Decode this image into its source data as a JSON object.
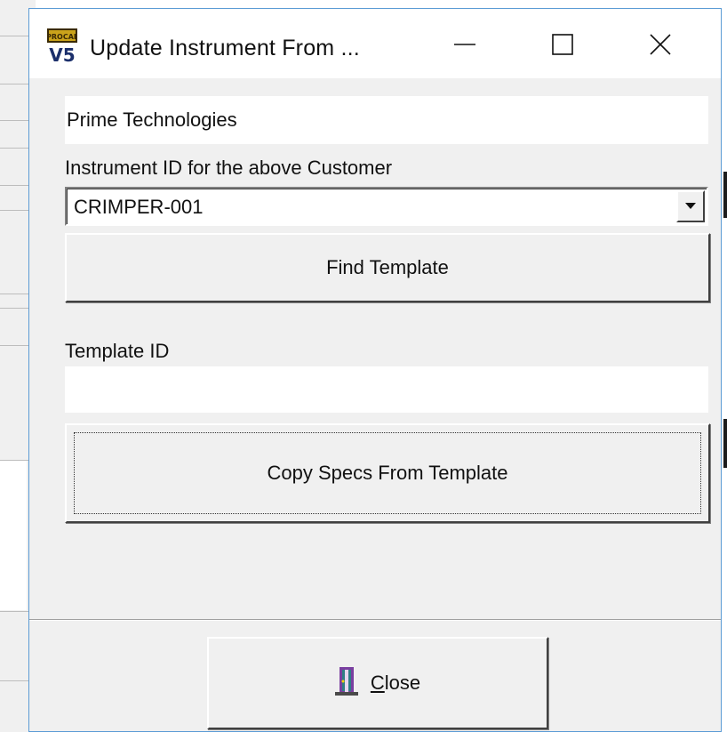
{
  "window": {
    "title": "Update Instrument From ...",
    "controls": {
      "minimize": "minimize-icon",
      "maximize": "maximize-icon",
      "close": "close-icon"
    }
  },
  "customer": {
    "value": "Prime Technologies"
  },
  "instrument": {
    "label": "Instrument ID for the above Customer",
    "selected": "CRIMPER-001"
  },
  "find_template_button": {
    "label": "Find Template"
  },
  "template": {
    "label": "Template ID",
    "value": ""
  },
  "copy_specs_button": {
    "label": "Copy Specs From Template"
  },
  "close_button": {
    "label_first": "C",
    "label_rest": "lose",
    "icon": "exit-door-icon"
  },
  "app_icon": {
    "text_top": "PROCAL",
    "text_bottom": "V5"
  }
}
